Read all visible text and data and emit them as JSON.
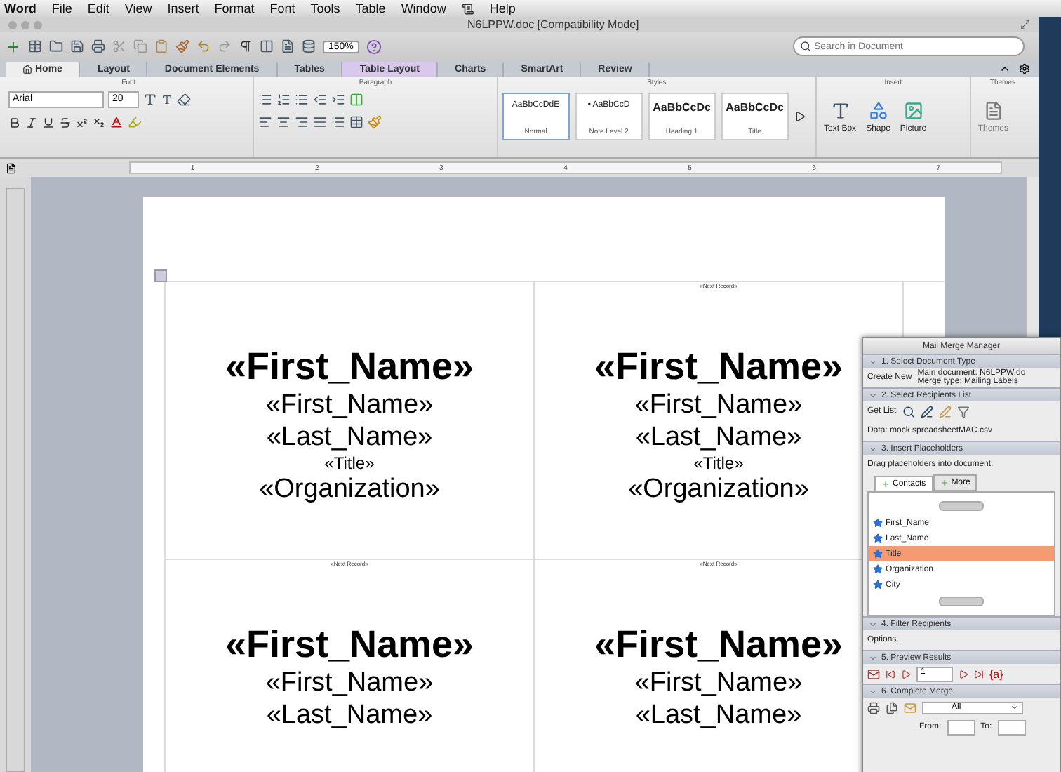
{
  "menu_bar": {
    "items": [
      {
        "kind": "app",
        "label": "Word"
      },
      {
        "kind": "menu",
        "label": "File"
      },
      {
        "kind": "menu",
        "label": "Edit"
      },
      {
        "kind": "menu",
        "label": "View"
      },
      {
        "kind": "menu",
        "label": "Insert"
      },
      {
        "kind": "menu",
        "label": "Format"
      },
      {
        "kind": "menu",
        "label": "Font"
      },
      {
        "kind": "menu",
        "label": "Tools"
      },
      {
        "kind": "menu",
        "label": "Table"
      },
      {
        "kind": "menu",
        "label": "Window"
      },
      {
        "kind": "script"
      },
      {
        "kind": "menu",
        "label": "Help"
      }
    ]
  },
  "window": {
    "title": "N6LPPW.doc [Compatibility Mode]"
  },
  "toolbar": {
    "zoom": "150%",
    "search": {
      "placeholder": "Search in Document"
    }
  },
  "tabs": [
    {
      "label": "Home",
      "selected": true,
      "contextual": false
    },
    {
      "label": "Layout",
      "selected": false,
      "contextual": false
    },
    {
      "label": "Document Elements",
      "selected": false,
      "contextual": false
    },
    {
      "label": "Tables",
      "selected": false,
      "contextual": false
    },
    {
      "label": "Table Layout",
      "selected": false,
      "contextual": true
    },
    {
      "label": "Charts",
      "selected": false,
      "contextual": false
    },
    {
      "label": "SmartArt",
      "selected": false,
      "contextual": false
    },
    {
      "label": "Review",
      "selected": false,
      "contextual": false
    }
  ],
  "ribbon": {
    "font": {
      "label": "Font",
      "font_name": "Arial",
      "font_size": "20"
    },
    "paragraph": {
      "label": "Paragraph"
    },
    "styles": {
      "label": "Styles",
      "items": [
        {
          "sample": "AaBbCcDdE",
          "name": "Normal",
          "selected": true
        },
        {
          "sample": "• AaBbCcD",
          "name": "Note Level 2",
          "selected": false
        },
        {
          "sample": "AaBbCcDc",
          "name": "Heading 1",
          "selected": false
        },
        {
          "sample": "AaBbCcDc",
          "name": "Title",
          "selected": false
        }
      ]
    },
    "insert": {
      "label": "Insert",
      "items": [
        "Text Box",
        "Shape",
        "Picture"
      ]
    },
    "themes": {
      "label": "Themes",
      "button": "Themes",
      "disabled": true
    }
  },
  "ruler": [
    "1",
    "2",
    "3",
    "4",
    "5",
    "6",
    "7"
  ],
  "labels": [
    [
      {
        "lines": [
          {
            "kind": "large",
            "text": "«First_Name»"
          },
          {
            "kind": "medium",
            "text": "«First_Name»"
          },
          {
            "kind": "medium",
            "text": "«Last_Name»"
          },
          {
            "kind": "small",
            "text": "«Title»"
          },
          {
            "kind": "medium",
            "text": "«Organization»"
          }
        ]
      },
      {
        "marker": "«Next Record»",
        "lines": [
          {
            "kind": "large",
            "text": "«First_Name»"
          },
          {
            "kind": "medium",
            "text": "«First_Name»"
          },
          {
            "kind": "medium",
            "text": "«Last_Name»"
          },
          {
            "kind": "small",
            "text": "«Title»"
          },
          {
            "kind": "medium",
            "text": "«Organization»"
          }
        ]
      }
    ],
    [
      {
        "marker": "«Next Record»",
        "lines": [
          {
            "kind": "large",
            "text": "«First_Name»"
          },
          {
            "kind": "medium",
            "text": "«First_Name»"
          },
          {
            "kind": "medium",
            "text": "«Last_Name»"
          }
        ]
      },
      {
        "marker": "«Next Record»",
        "lines": [
          {
            "kind": "large",
            "text": "«First_Name»"
          },
          {
            "kind": "medium",
            "text": "«First_Name»"
          },
          {
            "kind": "medium",
            "text": "«Last_Name»"
          }
        ]
      }
    ]
  ],
  "mail_merge": {
    "title": "Mail Merge Manager",
    "sections": [
      {
        "title": "1. Select Document Type",
        "expanded": true
      },
      {
        "title": "2. Select Recipients List",
        "expanded": true
      },
      {
        "title": "3. Insert Placeholders",
        "expanded": true
      },
      {
        "title": "4. Filter Recipients",
        "expanded": true
      },
      {
        "title": "5. Preview Results",
        "expanded": true
      },
      {
        "title": "6. Complete Merge",
        "expanded": true
      }
    ],
    "create_new": "Create New",
    "main_document": "Main document: N6LPPW.do",
    "merge_type": "Merge type: Mailing Labels",
    "get_list": "Get List",
    "data_source": "Data: mock spreadsheetMAC.csv",
    "drag_hint": "Drag placeholders into document:",
    "placeholder_tabs": [
      {
        "label": "Contacts",
        "selected": true
      },
      {
        "label": "More",
        "selected": false
      }
    ],
    "fields": [
      {
        "label": "First_Name",
        "selected": false
      },
      {
        "label": "Last_Name",
        "selected": false
      },
      {
        "label": "Title",
        "selected": true
      },
      {
        "label": "Organization",
        "selected": false
      },
      {
        "label": "City",
        "selected": false
      }
    ],
    "options": "Options...",
    "record": "1",
    "field_codes": "{a}",
    "merge_to": "All",
    "from": "From:",
    "to": "To:"
  }
}
